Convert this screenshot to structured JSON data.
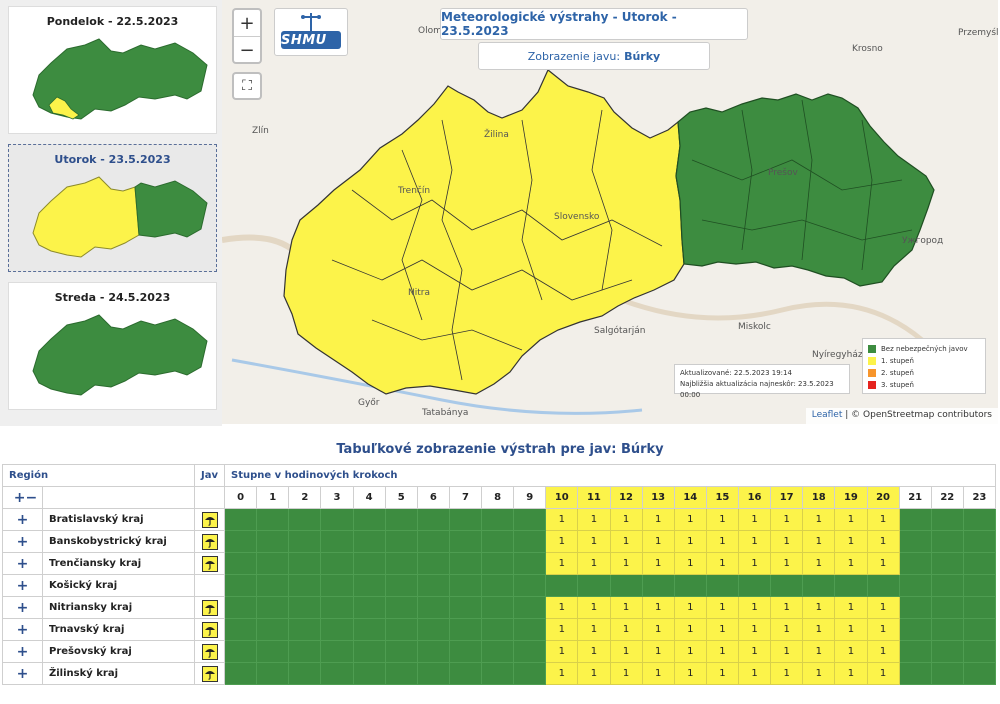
{
  "days": [
    {
      "label": "Pondelok - 22.5.2023"
    },
    {
      "label": "Utorok - 23.5.2023"
    },
    {
      "label": "Streda - 24.5.2023"
    }
  ],
  "map": {
    "title": "Meteorologické výstrahy - Utorok - 23.5.2023",
    "subtitle_prefix": "Zobrazenie javu:",
    "subtitle_value": "Búrky",
    "logo_text": "SHMU",
    "zoom_in": "+",
    "zoom_out": "−",
    "fullscreen": "⛶",
    "updated": "Aktualizované: 22.5.2023 19:14",
    "next_update": "Najbližšia aktualizácia najneskôr: 23.5.2023 00:00",
    "legend": [
      {
        "label": "Bez nebezpečných javov",
        "color": "#3d8c40"
      },
      {
        "label": "1. stupeň",
        "color": "#fcf34a"
      },
      {
        "label": "2. stupeň",
        "color": "#f7952b"
      },
      {
        "label": "3. stupeň",
        "color": "#e5231e"
      }
    ],
    "attribution_leaflet": "Leaflet",
    "attribution_rest": "| © OpenStreetmap contributors",
    "places": [
      "Olomouc",
      "Zlín",
      "Krosno",
      "Przemyśl",
      "Žilina",
      "Trenčín",
      "Slovensko",
      "Prešov",
      "Nitra",
      "Salgótarján",
      "Miskolc",
      "Nyíregyháza",
      "Győr",
      "Tatabánya",
      "Ужгород"
    ]
  },
  "table": {
    "title": "Tabuľkové zobrazenie výstrah pre jav: Búrky",
    "col_region": "Región",
    "col_jav": "Jav",
    "col_hours": "Stupne v hodinových krokoch",
    "expand_all": "+−",
    "hours": [
      "0",
      "1",
      "2",
      "3",
      "4",
      "5",
      "6",
      "7",
      "8",
      "9",
      "10",
      "11",
      "12",
      "13",
      "14",
      "15",
      "16",
      "17",
      "18",
      "19",
      "20",
      "21",
      "22",
      "23"
    ],
    "rows": [
      {
        "name": "Bratislavský kraj",
        "storm": true,
        "levels": [
          0,
          0,
          0,
          0,
          0,
          0,
          0,
          0,
          0,
          0,
          1,
          1,
          1,
          1,
          1,
          1,
          1,
          1,
          1,
          1,
          1,
          0,
          0,
          0
        ]
      },
      {
        "name": "Banskobystrický kraj",
        "storm": true,
        "levels": [
          0,
          0,
          0,
          0,
          0,
          0,
          0,
          0,
          0,
          0,
          1,
          1,
          1,
          1,
          1,
          1,
          1,
          1,
          1,
          1,
          1,
          0,
          0,
          0
        ]
      },
      {
        "name": "Trenčiansky kraj",
        "storm": true,
        "levels": [
          0,
          0,
          0,
          0,
          0,
          0,
          0,
          0,
          0,
          0,
          1,
          1,
          1,
          1,
          1,
          1,
          1,
          1,
          1,
          1,
          1,
          0,
          0,
          0
        ]
      },
      {
        "name": "Košický kraj",
        "storm": false,
        "levels": [
          0,
          0,
          0,
          0,
          0,
          0,
          0,
          0,
          0,
          0,
          0,
          0,
          0,
          0,
          0,
          0,
          0,
          0,
          0,
          0,
          0,
          0,
          0,
          0
        ]
      },
      {
        "name": "Nitriansky kraj",
        "storm": true,
        "levels": [
          0,
          0,
          0,
          0,
          0,
          0,
          0,
          0,
          0,
          0,
          1,
          1,
          1,
          1,
          1,
          1,
          1,
          1,
          1,
          1,
          1,
          0,
          0,
          0
        ]
      },
      {
        "name": "Trnavský kraj",
        "storm": true,
        "levels": [
          0,
          0,
          0,
          0,
          0,
          0,
          0,
          0,
          0,
          0,
          1,
          1,
          1,
          1,
          1,
          1,
          1,
          1,
          1,
          1,
          1,
          0,
          0,
          0
        ]
      },
      {
        "name": "Prešovský kraj",
        "storm": true,
        "levels": [
          0,
          0,
          0,
          0,
          0,
          0,
          0,
          0,
          0,
          0,
          1,
          1,
          1,
          1,
          1,
          1,
          1,
          1,
          1,
          1,
          1,
          0,
          0,
          0
        ]
      },
      {
        "name": "Žilinský kraj",
        "storm": true,
        "levels": [
          0,
          0,
          0,
          0,
          0,
          0,
          0,
          0,
          0,
          0,
          1,
          1,
          1,
          1,
          1,
          1,
          1,
          1,
          1,
          1,
          1,
          0,
          0,
          0
        ]
      }
    ],
    "row_expand": "+"
  }
}
